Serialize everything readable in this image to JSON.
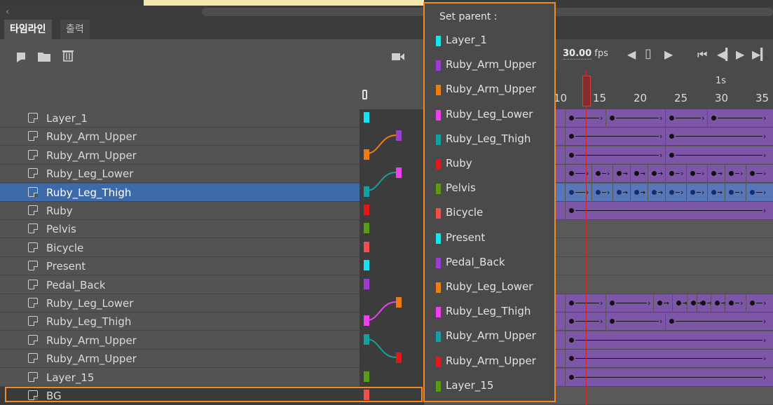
{
  "tabs": {
    "timeline": "타임라인",
    "output": "출력"
  },
  "toolbar": {
    "new_layer_icon": "new-layer-icon",
    "folder_icon": "folder-icon",
    "delete_icon": "trash-icon",
    "camera_icon": "camera-icon"
  },
  "playback": {
    "fps_value": "30.00",
    "fps_unit": "fps"
  },
  "ruler": {
    "seconds_label": "1s",
    "marks": [
      "10",
      "15",
      "20",
      "25",
      "30",
      "35"
    ]
  },
  "layers": [
    {
      "name": "Layer_1",
      "color": "#19e3ee"
    },
    {
      "name": "Ruby_Arm_Upper",
      "color": "#9a3ed0"
    },
    {
      "name": "Ruby_Arm_Upper",
      "color": "#f07c10"
    },
    {
      "name": "Ruby_Leg_Lower",
      "color": "#ee40ee"
    },
    {
      "name": "Ruby_Leg_Thigh",
      "color": "#14a0a0",
      "selected": true
    },
    {
      "name": "Ruby",
      "color": "#e01818"
    },
    {
      "name": "Pelvis",
      "color": "#5a9a14"
    },
    {
      "name": "Bicycle",
      "color": "#ee5050"
    },
    {
      "name": "Present",
      "color": "#19e3ee"
    },
    {
      "name": "Pedal_Back",
      "color": "#9a3ed0"
    },
    {
      "name": "Ruby_Leg_Lower",
      "color": "#f07c10"
    },
    {
      "name": "Ruby_Leg_Thigh",
      "color": "#ee40ee"
    },
    {
      "name": "Ruby_Arm_Upper",
      "color": "#14a0a0"
    },
    {
      "name": "Ruby_Arm_Upper",
      "color": "#e01818"
    },
    {
      "name": "Layer_15",
      "color": "#5a9a14"
    },
    {
      "name": "BG",
      "color": "#ee5050"
    }
  ],
  "popup": {
    "title": "Set parent :",
    "items": [
      {
        "label": "Layer_1",
        "color": "#19e3ee"
      },
      {
        "label": "Ruby_Arm_Upper",
        "color": "#9a3ed0"
      },
      {
        "label": "Ruby_Arm_Upper",
        "color": "#f07c10"
      },
      {
        "label": "Ruby_Leg_Lower",
        "color": "#ee40ee"
      },
      {
        "label": "Ruby_Leg_Thigh",
        "color": "#14a0a0"
      },
      {
        "label": "Ruby",
        "color": "#e01818"
      },
      {
        "label": "Pelvis",
        "color": "#5a9a14"
      },
      {
        "label": "Bicycle",
        "color": "#ee5050"
      },
      {
        "label": "Present",
        "color": "#19e3ee"
      },
      {
        "label": "Pedal_Back",
        "color": "#9a3ed0"
      },
      {
        "label": "Ruby_Leg_Lower",
        "color": "#f07c10"
      },
      {
        "label": "Ruby_Leg_Thigh",
        "color": "#ee40ee"
      },
      {
        "label": "Ruby_Arm_Upper",
        "color": "#14a0a0"
      },
      {
        "label": "Ruby_Arm_Upper",
        "color": "#e01818"
      },
      {
        "label": "Layer_15",
        "color": "#5a9a14"
      }
    ]
  }
}
